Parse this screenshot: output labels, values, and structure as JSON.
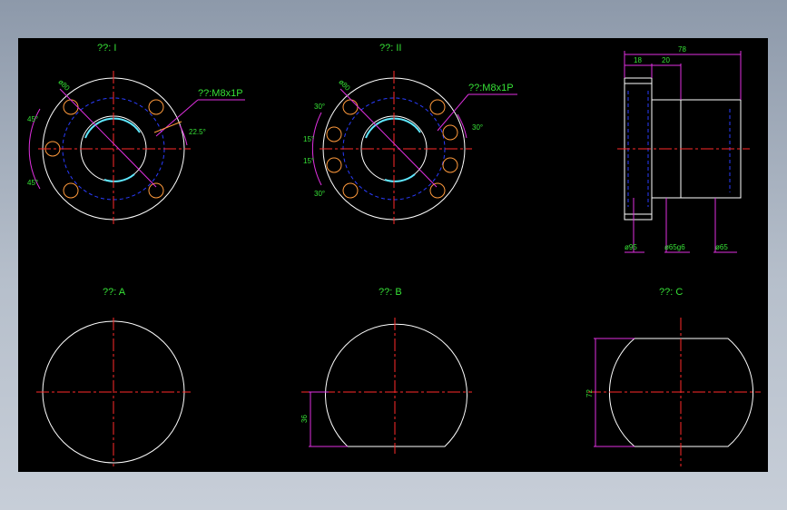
{
  "drawing": {
    "view_I_title": "??: I",
    "view_II_title": "??: II",
    "view_A_title": "??: A",
    "view_B_title": "??: B",
    "view_C_title": "??: C",
    "view_I": {
      "thread_label": "??:M8x1P",
      "dia_label": "ø80",
      "angle_top": "45°",
      "angle_bottom": "45°",
      "angle_right": "22.5°"
    },
    "view_II": {
      "thread_label": "??:M8x1P",
      "dia_label": "ø80",
      "angle_1": "30°",
      "angle_2": "15°",
      "angle_3": "15°",
      "angle_4": "30°",
      "angle_right": "30°"
    },
    "side_view": {
      "overall_length": "78",
      "flange_width": "18",
      "step_width": "20",
      "dia_flange": "ø95",
      "dia_body": "ø65g6",
      "dia_end": "ø65"
    },
    "view_B": {
      "height_label": "36"
    },
    "view_C": {
      "height_label": "72"
    }
  },
  "colors": {
    "background": "#000000",
    "outline": "#ffffff",
    "centerline": "#ff2a2a",
    "hidden": "#2a3cff",
    "dimension": "#e030e0",
    "text": "#36e136",
    "thread": "#5fe8ff",
    "holes": "#ff9a3c"
  }
}
